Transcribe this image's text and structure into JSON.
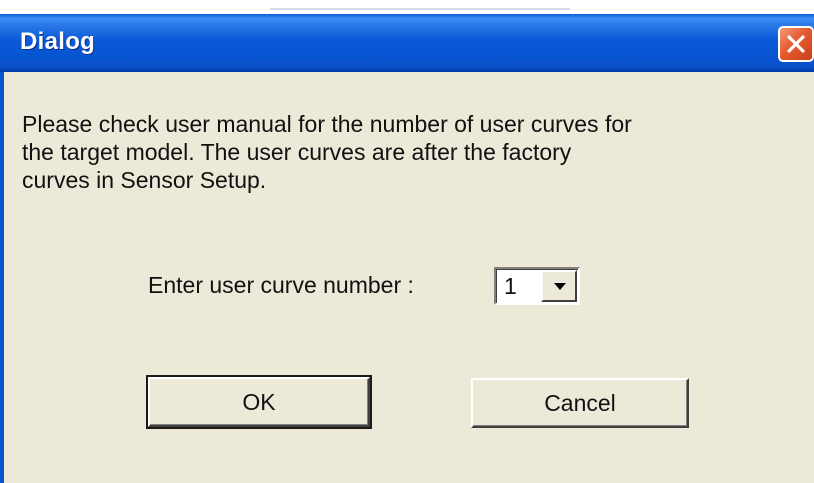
{
  "window": {
    "title": "Dialog",
    "close_icon": "close-icon"
  },
  "message": {
    "lines": [
      "Please check user manual for the number of user curves for",
      "the target model. The user curves are after the factory",
      "curves in Sensor Setup."
    ]
  },
  "curve_select": {
    "label": "Enter user curve number :",
    "value": "1",
    "arrow_icon": "chevron-down-icon"
  },
  "buttons": {
    "ok": "OK",
    "cancel": "Cancel"
  },
  "colors": {
    "titlebar": "#0654d0",
    "window_bg": "#ece9d8",
    "close_button": "#e65a2f"
  }
}
